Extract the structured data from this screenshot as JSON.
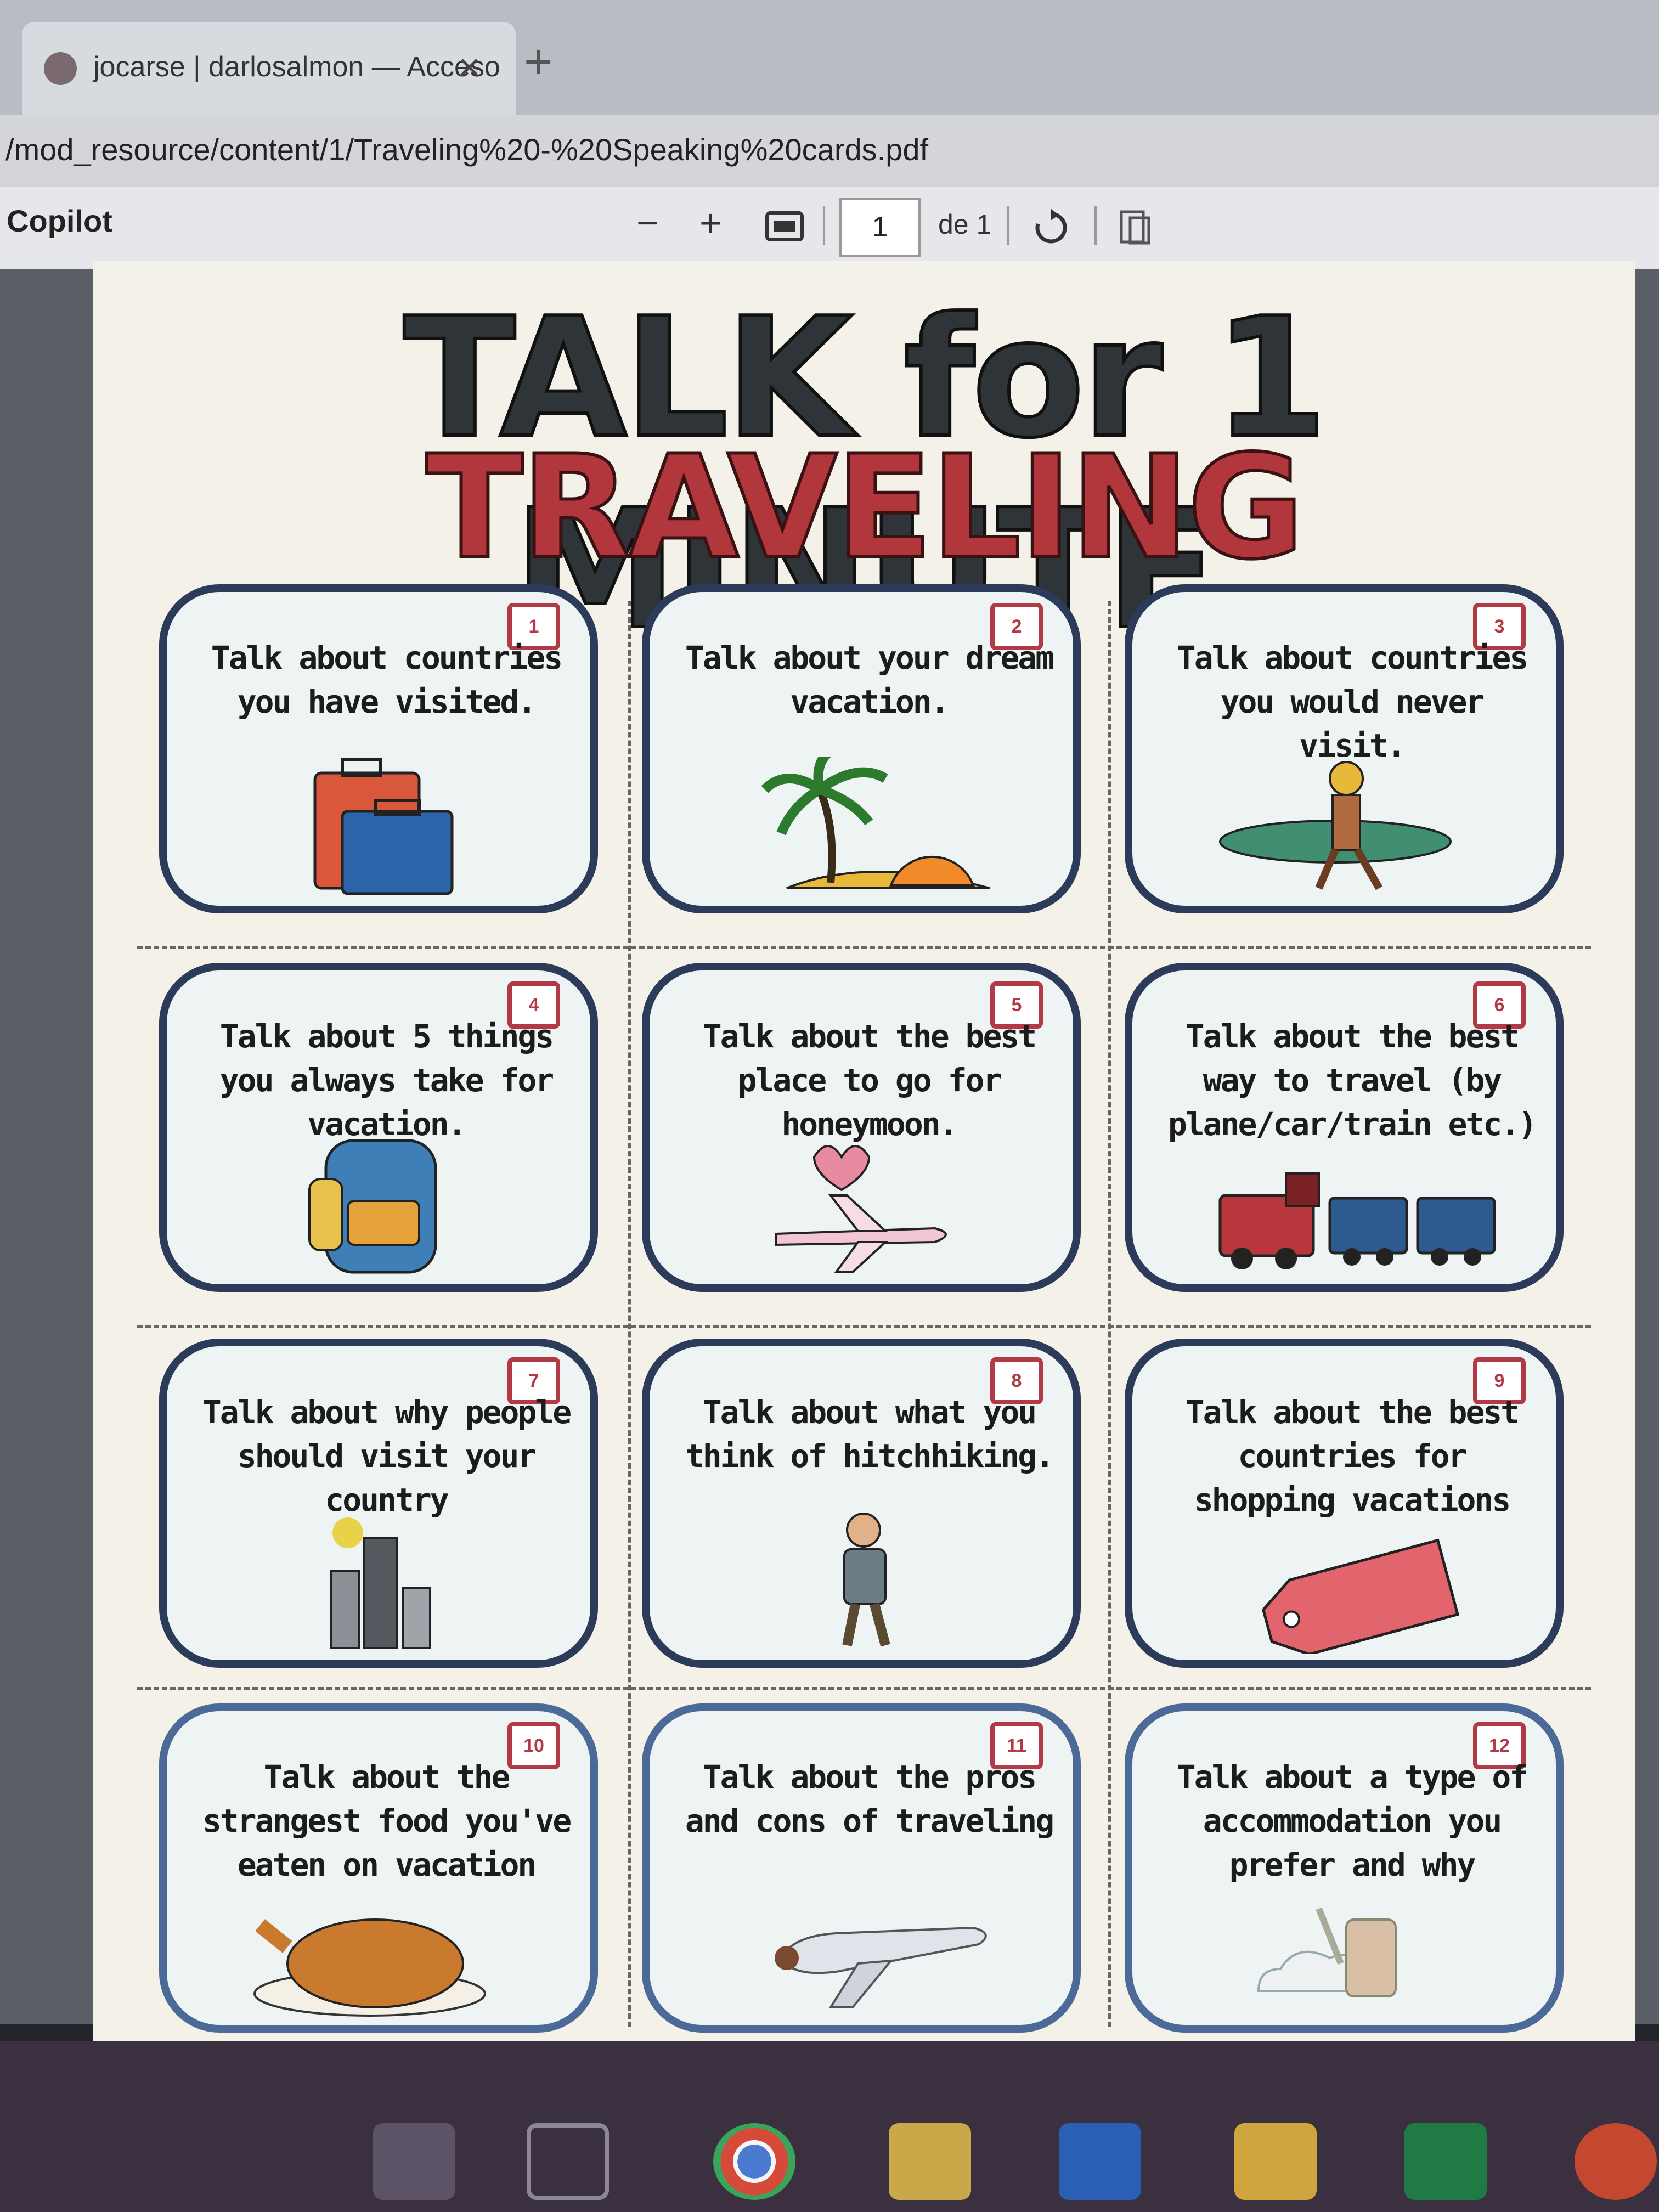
{
  "browser": {
    "tab_title": "jocarse | darlosalmon — Acceso",
    "tab_close": "×",
    "new_tab": "+",
    "url": "/mod_resource/content/1/Traveling%20-%20Speaking%20cards.pdf"
  },
  "pdf_toolbar": {
    "copilot_label": "Copilot",
    "zoom_out": "−",
    "zoom_in": "+",
    "page_current": "1",
    "page_of": "de 1"
  },
  "document": {
    "title": "TALK for 1 MINUTE",
    "subtitle": "TRAVELING",
    "cards": [
      {
        "num": "1",
        "text": "Talk about countries you have visited.",
        "icon": "suitcase-icon"
      },
      {
        "num": "2",
        "text": "Talk about your dream vacation.",
        "icon": "palm-island-icon"
      },
      {
        "num": "3",
        "text": "Talk about countries you would never visit.",
        "icon": "surfer-icon"
      },
      {
        "num": "4",
        "text": "Talk about 5 things you always take for vacation.",
        "icon": "backpack-icon"
      },
      {
        "num": "5",
        "text": "Talk about the best place to go for honeymoon.",
        "icon": "honeymoon-plane-icon"
      },
      {
        "num": "6",
        "text": "Talk about the best way to travel (by plane/car/train etc.)",
        "icon": "train-icon"
      },
      {
        "num": "7",
        "text": "Talk about why people should visit your country",
        "icon": "city-icon"
      },
      {
        "num": "8",
        "text": "Talk about what you think of hitchhiking.",
        "icon": "hitchhiker-icon"
      },
      {
        "num": "9",
        "text": "Talk about the best countries for shopping vacations",
        "icon": "sale-tag-icon"
      },
      {
        "num": "10",
        "text": "Talk about the strangest food you've eaten on vacation",
        "icon": "roast-chicken-icon"
      },
      {
        "num": "11",
        "text": "Talk about the pros and cons of traveling",
        "icon": "airplane-icon"
      },
      {
        "num": "12",
        "text": "Talk about a type of accommodation you prefer and why",
        "icon": "room-key-icon"
      }
    ]
  },
  "taskbar": {
    "apps": [
      "file-explorer-icon",
      "task-view-icon",
      "chrome-icon",
      "folder-icon",
      "word-icon",
      "store-icon",
      "excel-icon",
      "powerpoint-icon"
    ]
  },
  "colors": {
    "title": "#2f3438",
    "subtitle": "#b2373c",
    "card_border": "#2d3b5a",
    "number_box": "#b23a46"
  }
}
